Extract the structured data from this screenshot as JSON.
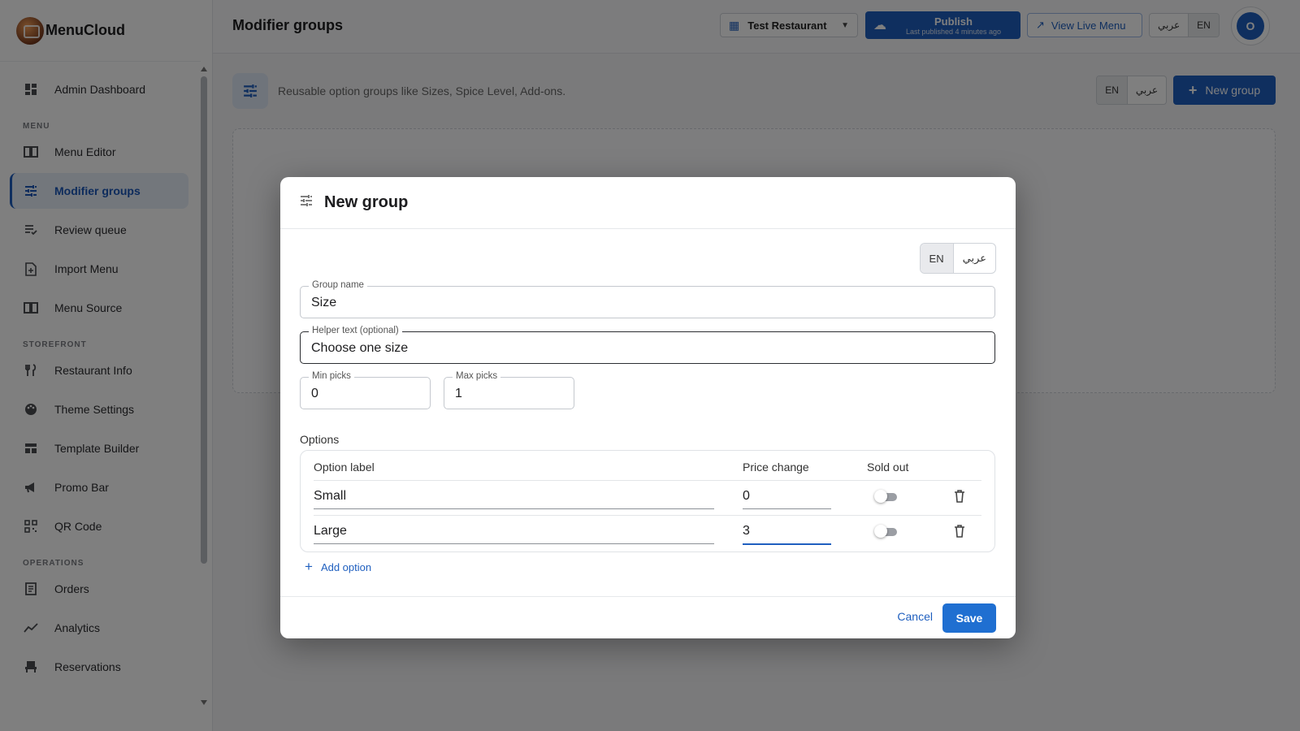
{
  "app": {
    "name": "MenuCloud"
  },
  "sidebar": {
    "top_item": {
      "label": "Admin Dashboard",
      "icon": "dashboard-icon"
    },
    "sections": [
      {
        "title": "MENU",
        "items": [
          {
            "label": "Menu Editor",
            "icon": "book-icon"
          },
          {
            "label": "Modifier groups",
            "icon": "tune-icon",
            "active": true
          },
          {
            "label": "Review queue",
            "icon": "review-icon"
          },
          {
            "label": "Import Menu",
            "icon": "import-icon"
          },
          {
            "label": "Menu Source",
            "icon": "book-icon"
          }
        ]
      },
      {
        "title": "STOREFRONT",
        "items": [
          {
            "label": "Restaurant Info",
            "icon": "restaurant-icon"
          },
          {
            "label": "Theme Settings",
            "icon": "palette-icon"
          },
          {
            "label": "Template Builder",
            "icon": "template-icon"
          },
          {
            "label": "Promo Bar",
            "icon": "megaphone-icon"
          },
          {
            "label": "QR Code",
            "icon": "qr-code-icon"
          }
        ]
      },
      {
        "title": "OPERATIONS",
        "items": [
          {
            "label": "Orders",
            "icon": "receipt-icon"
          },
          {
            "label": "Analytics",
            "icon": "analytics-icon"
          },
          {
            "label": "Reservations",
            "icon": "chair-icon"
          }
        ]
      }
    ]
  },
  "header": {
    "title": "Modifier groups",
    "restaurant": "Test Restaurant",
    "publish": {
      "label": "Publish",
      "sub": "Last published 4 minutes ago"
    },
    "live_menu": "View Live Menu",
    "lang_ar": "عربي",
    "lang_en": "EN",
    "avatar_initial": "O"
  },
  "content": {
    "description": "Reusable option groups like Sizes, Spice Level, Add-ons.",
    "lang_en": "EN",
    "lang_ar": "عربي",
    "new_group": "New group"
  },
  "modal": {
    "title": "New group",
    "lang_en": "EN",
    "lang_ar": "عربي",
    "group_name": {
      "label": "Group name",
      "value": "Size"
    },
    "helper_text": {
      "label": "Helper text (optional)",
      "value": "Choose one size"
    },
    "min_picks": {
      "label": "Min picks",
      "value": "0"
    },
    "max_picks": {
      "label": "Max picks",
      "value": "1"
    },
    "options_title": "Options",
    "columns": {
      "label": "Option label",
      "price": "Price change",
      "sold_out": "Sold out"
    },
    "rows": [
      {
        "label": "Small",
        "price": "0",
        "sold_out": false
      },
      {
        "label": "Large",
        "price": "3",
        "sold_out": false
      }
    ],
    "add_option": "Add option",
    "cancel": "Cancel",
    "save": "Save"
  },
  "colors": {
    "primary": "#1f5fbf",
    "active_bg": "#e7eef9"
  }
}
